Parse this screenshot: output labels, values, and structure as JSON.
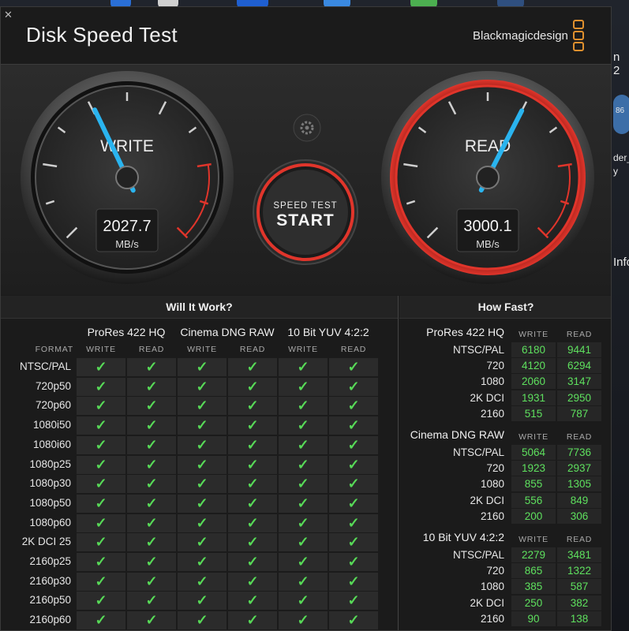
{
  "app": {
    "title": "Disk Speed Test",
    "brand": "Blackmagicdesign",
    "close": "✕"
  },
  "colors": {
    "accent_red": "#e0352b",
    "needle_blue": "#2ab4ef",
    "check_green": "#57d957",
    "logo_orange": "#e0902e"
  },
  "desktop": {
    "right_text_1": "n 2",
    "right_text_2": "der_",
    "right_text_3": "y",
    "right_text_4": "Info",
    "badge": "86"
  },
  "write_gauge": {
    "label": "WRITE",
    "value": "2027.7",
    "unit": "MB/s",
    "max_scale": 5000
  },
  "read_gauge": {
    "label": "READ",
    "value": "3000.1",
    "unit": "MB/s",
    "max_scale": 5000
  },
  "start_button": {
    "line1": "SPEED TEST",
    "line2": "START"
  },
  "will_it_work": {
    "header": "Will It Work?",
    "format_label": "FORMAT",
    "groups": [
      {
        "name": "ProRes 422 HQ",
        "write": "WRITE",
        "read": "READ"
      },
      {
        "name": "Cinema DNG RAW",
        "write": "WRITE",
        "read": "READ"
      },
      {
        "name": "10 Bit YUV 4:2:2",
        "write": "WRITE",
        "read": "READ"
      }
    ],
    "rows": [
      "NTSC/PAL",
      "720p50",
      "720p60",
      "1080i50",
      "1080i60",
      "1080p25",
      "1080p30",
      "1080p50",
      "1080p60",
      "2K DCI 25",
      "2160p25",
      "2160p30",
      "2160p50",
      "2160p60"
    ],
    "check": "✓"
  },
  "how_fast": {
    "header": "How Fast?",
    "write_label": "WRITE",
    "read_label": "READ",
    "groups": [
      {
        "name": "ProRes 422 HQ",
        "rows": [
          {
            "label": "NTSC/PAL",
            "write": "6180",
            "read": "9441"
          },
          {
            "label": "720",
            "write": "4120",
            "read": "6294"
          },
          {
            "label": "1080",
            "write": "2060",
            "read": "3147"
          },
          {
            "label": "2K DCI",
            "write": "1931",
            "read": "2950"
          },
          {
            "label": "2160",
            "write": "515",
            "read": "787"
          }
        ]
      },
      {
        "name": "Cinema DNG RAW",
        "rows": [
          {
            "label": "NTSC/PAL",
            "write": "5064",
            "read": "7736"
          },
          {
            "label": "720",
            "write": "1923",
            "read": "2937"
          },
          {
            "label": "1080",
            "write": "855",
            "read": "1305"
          },
          {
            "label": "2K DCI",
            "write": "556",
            "read": "849"
          },
          {
            "label": "2160",
            "write": "200",
            "read": "306"
          }
        ]
      },
      {
        "name": "10 Bit YUV 4:2:2",
        "rows": [
          {
            "label": "NTSC/PAL",
            "write": "2279",
            "read": "3481"
          },
          {
            "label": "720",
            "write": "865",
            "read": "1322"
          },
          {
            "label": "1080",
            "write": "385",
            "read": "587"
          },
          {
            "label": "2K DCI",
            "write": "250",
            "read": "382"
          },
          {
            "label": "2160",
            "write": "90",
            "read": "138"
          }
        ]
      }
    ]
  }
}
